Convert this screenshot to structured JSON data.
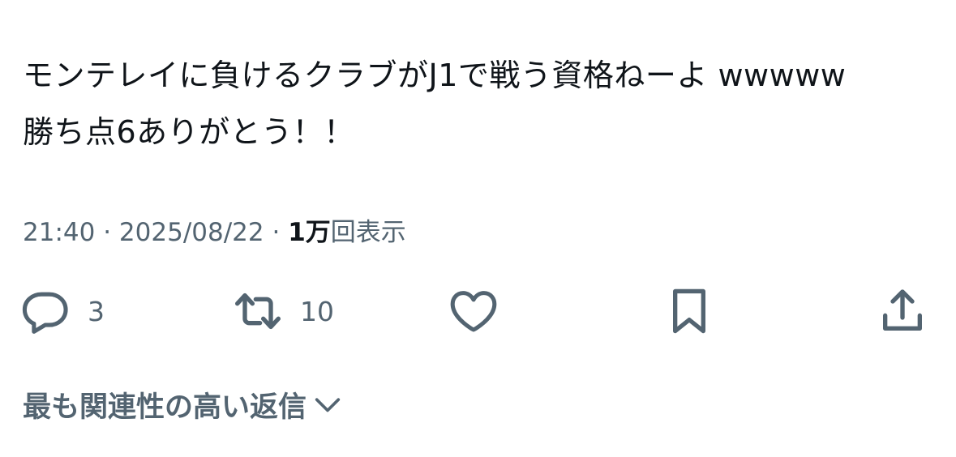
{
  "tweet": {
    "lines": [
      "モンテレイに負けるクラブがJ1で戦う資格ねーよ wwwww",
      "勝ち点6ありがとう！！"
    ]
  },
  "meta": {
    "time": "21:40",
    "separator": "·",
    "date": "2025/08/22",
    "views_count": "1万",
    "views_label": "回表示"
  },
  "actions": {
    "reply": {
      "icon": "reply-icon",
      "count": "3"
    },
    "retweet": {
      "icon": "retweet-icon",
      "count": "10"
    },
    "like": {
      "icon": "heart-icon"
    },
    "bookmark": {
      "icon": "bookmark-icon"
    },
    "share": {
      "icon": "share-icon"
    }
  },
  "replies_sort": {
    "label": "最も関連性の高い返信",
    "icon": "chevron-down-icon"
  },
  "colors": {
    "text": "#0f1419",
    "secondary": "#536471",
    "background": "#ffffff"
  }
}
